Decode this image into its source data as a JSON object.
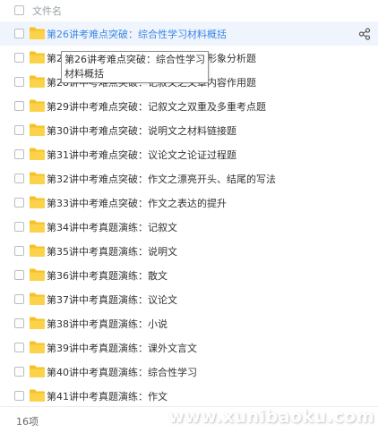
{
  "header": {
    "column_label": "文件名"
  },
  "files": [
    "第26讲考难点突破：综合性学习材料概括",
    "第27讲中考难点突破：记叙文之人物形象分析题",
    "第28讲中考难点突破：记叙文之文章内容作用题",
    "第29讲中考难点突破：记叙文之双重及多重考点题",
    "第30讲中考难点突破：说明文之材料链接题",
    "第31讲中考难点突破：议论文之论证过程题",
    "第32讲中考难点突破：作文之漂亮开头、结尾的写法",
    "第33讲中考难点突破：作文之表达的提升",
    "第34讲中考真题演练：记叙文",
    "第35讲中考真题演练：说明文",
    "第36讲中考真题演练：散文",
    "第37讲中考真题演练：议论文",
    "第38讲中考真题演练：小说",
    "第39讲中考真题演练：课外文言文",
    "第40讲中考真题演练：综合性学习",
    "第41讲中考真题演练：作文"
  ],
  "tooltip": {
    "text": "第26讲考难点突破：综合性学习材料概括"
  },
  "footer": {
    "count": "16项"
  },
  "watermark": "www.xunibaoku.com",
  "colors": {
    "folder": "#f7c125",
    "selected_text": "#3b86e6",
    "selected_bg": "#f0f5fd"
  },
  "icons": {
    "row_icon": "folder-icon",
    "share": "share-icon"
  }
}
